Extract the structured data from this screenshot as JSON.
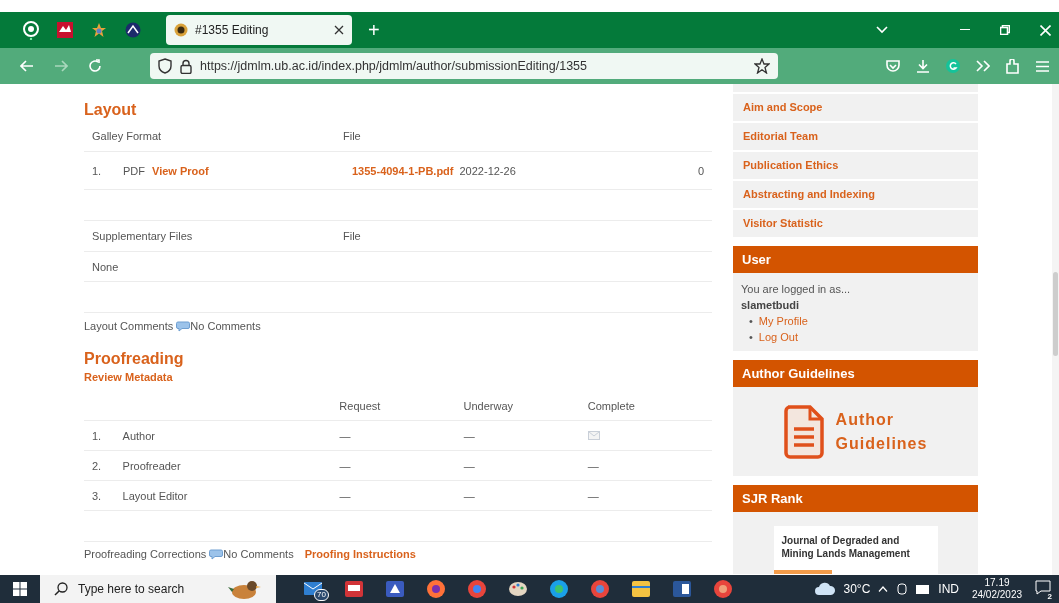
{
  "browser": {
    "tab_title": "#1355 Editing",
    "new_tab": "+",
    "url": "https://jdmlm.ub.ac.id/index.php/jdmlm/author/submissionEditing/1355"
  },
  "layout": {
    "title": "Layout",
    "galley_columns": [
      "Galley Format",
      "File"
    ],
    "galleys": [
      {
        "number": "1.",
        "format": "PDF",
        "link": "View Proof",
        "file": "1355-4094-1-PB.pdf",
        "date": "2022-12-26",
        "count": "0"
      }
    ],
    "supp_columns": [
      "Supplementary Files",
      "File"
    ],
    "supp_rows": [
      "None"
    ],
    "comments_label": "Layout Comments",
    "comments": "No Comments"
  },
  "proofreading": {
    "title": "Proofreading",
    "review_link": "Review Metadata",
    "columns": [
      "Request",
      "Underway",
      "Complete"
    ],
    "rows": [
      {
        "number": "1.",
        "role": "Author",
        "cells": [
          {
            "kind": "text",
            "text": "—"
          },
          {
            "kind": "text",
            "text": "—"
          },
          {
            "kind": "icon"
          }
        ]
      },
      {
        "number": "2.",
        "role": "Proofreader",
        "cells": [
          {
            "kind": "text",
            "text": "—"
          },
          {
            "kind": "text",
            "text": "—"
          },
          {
            "kind": "text",
            "text": "—"
          }
        ]
      },
      {
        "number": "3.",
        "role": "Layout Editor",
        "cells": [
          {
            "kind": "text",
            "text": "—"
          },
          {
            "kind": "text",
            "text": "—"
          },
          {
            "kind": "text",
            "text": "—"
          }
        ]
      }
    ],
    "corrections_label": "Proofreading Corrections",
    "corrections": "No Comments",
    "instructions_link": "Proofing Instructions"
  },
  "sidebar": {
    "nav_links": [
      "Aim and Scope",
      "Editorial Team",
      "Publication Ethics",
      "Abstracting and Indexing",
      "Visitor Statistic"
    ],
    "user": {
      "title": "User",
      "logged_in": "You are logged in as...",
      "username": "slametbudi",
      "links": [
        {
          "bullet": "•",
          "text": "My Profile"
        },
        {
          "bullet": "•",
          "text": "Log Out"
        }
      ]
    },
    "guidelines": {
      "title": "Author Guidelines",
      "banner_lines": [
        "Author",
        "Guidelines"
      ]
    },
    "sjr": {
      "title": "SJR Rank",
      "journal": "Journal of Degraded and Mining Lands Management"
    }
  },
  "taskbar": {
    "search_placeholder": "Type here to search",
    "mail_badge": "70",
    "weather": "30°C",
    "language": "IND",
    "time": "17.19",
    "date": "24/02/2023",
    "notifications": "2"
  }
}
